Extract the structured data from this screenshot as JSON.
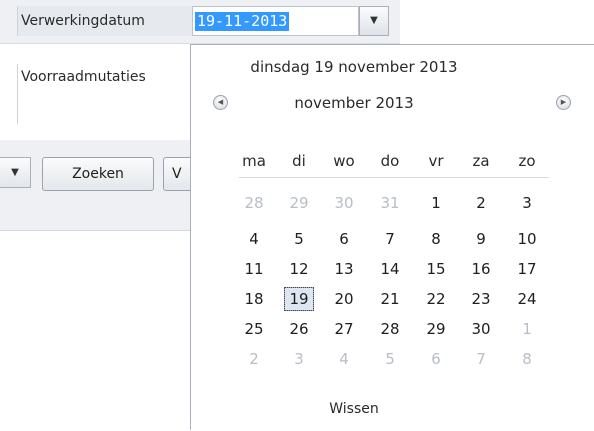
{
  "filter": {
    "label": "Verwerkingdatum",
    "date_value": "19-11-2013"
  },
  "section": {
    "label": "Voorraadmutaties"
  },
  "toolbar": {
    "search_label": "Zoeken",
    "next_button_label": "V"
  },
  "calendar": {
    "date_title": "dinsdag 19 november 2013",
    "month_label": "november 2013",
    "weekdays": [
      "ma",
      "di",
      "wo",
      "do",
      "vr",
      "za",
      "zo"
    ],
    "weeks": [
      [
        "28",
        "29",
        "30",
        "31",
        "1",
        "2",
        "3"
      ],
      [
        "4",
        "5",
        "6",
        "7",
        "8",
        "9",
        "10"
      ],
      [
        "11",
        "12",
        "13",
        "14",
        "15",
        "16",
        "17"
      ],
      [
        "18",
        "19",
        "20",
        "21",
        "22",
        "23",
        "24"
      ],
      [
        "25",
        "26",
        "27",
        "28",
        "29",
        "30",
        "1"
      ],
      [
        "2",
        "3",
        "4",
        "5",
        "6",
        "7",
        "8"
      ]
    ],
    "muted": [
      [
        true,
        true,
        true,
        true,
        false,
        false,
        false
      ],
      [
        false,
        false,
        false,
        false,
        false,
        false,
        false
      ],
      [
        false,
        false,
        false,
        false,
        false,
        false,
        false
      ],
      [
        false,
        false,
        false,
        false,
        false,
        false,
        false
      ],
      [
        false,
        false,
        false,
        false,
        false,
        false,
        true
      ],
      [
        true,
        true,
        true,
        true,
        true,
        true,
        true
      ]
    ],
    "selected_day": "19",
    "clear_label": "Wissen",
    "icons": {
      "prev": "chevron-left-icon",
      "next": "chevron-right-icon",
      "dropdown": "chevron-down-icon"
    },
    "colors": {
      "selection": "#3399ff",
      "muted_day": "#b8bec5"
    }
  }
}
